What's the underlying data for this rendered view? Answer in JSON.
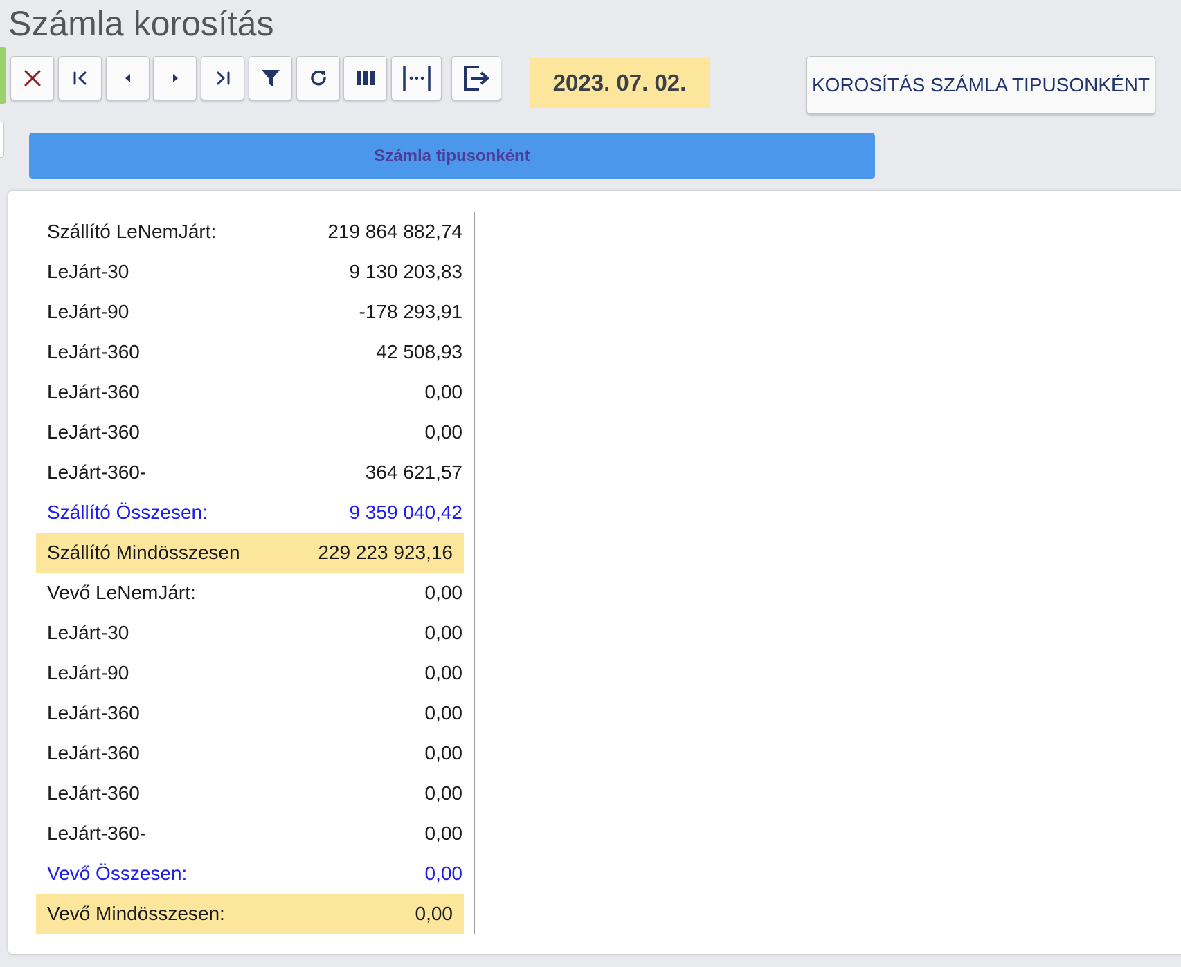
{
  "page": {
    "title": "Számla korosítás"
  },
  "toolbar": {
    "buttons": [
      {
        "name": "close-button",
        "icon": "close-icon"
      },
      {
        "name": "first-record-button",
        "icon": "first-icon"
      },
      {
        "name": "previous-record-button",
        "icon": "prev-icon"
      },
      {
        "name": "next-record-button",
        "icon": "next-icon"
      },
      {
        "name": "last-record-button",
        "icon": "last-icon"
      },
      {
        "name": "filter-button",
        "icon": "filter-icon"
      },
      {
        "name": "refresh-button",
        "icon": "refresh-icon"
      },
      {
        "name": "columns-button",
        "icon": "columns-icon"
      },
      {
        "name": "column-width-button",
        "icon": "column-width-icon"
      },
      {
        "name": "export-button",
        "icon": "export-icon"
      }
    ],
    "date": "2023. 07. 02.",
    "report_button_label": "KOROSÍTÁS SZÁMLA TIPUSONKÉNT"
  },
  "tab": {
    "label": "Számla tipusonként"
  },
  "colors": {
    "background": "#e9eaee",
    "tab_bar": "#4a97ec",
    "tab_text": "#4e3c98",
    "highlight": "#fce69c",
    "subtotal_text": "#1d1ded",
    "close_icon": "#8c1f1f",
    "toolbar_icon": "#22356a"
  },
  "rows": [
    {
      "label": "Szállító LeNemJárt:",
      "value": "219 864 882,74",
      "kind": "normal"
    },
    {
      "label": "LeJárt-30",
      "value": "9 130 203,83",
      "kind": "normal"
    },
    {
      "label": "LeJárt-90",
      "value": "-178 293,91",
      "kind": "normal"
    },
    {
      "label": "LeJárt-360",
      "value": "42 508,93",
      "kind": "normal"
    },
    {
      "label": "LeJárt-360",
      "value": "0,00",
      "kind": "normal"
    },
    {
      "label": "LeJárt-360",
      "value": "0,00",
      "kind": "normal"
    },
    {
      "label": "LeJárt-360-",
      "value": "364 621,57",
      "kind": "normal"
    },
    {
      "label": "Szállító Összesen:",
      "value": "9 359 040,42",
      "kind": "subtotal"
    },
    {
      "label": "Szállító Mindösszesen",
      "value": "229 223 923,16",
      "kind": "grand"
    },
    {
      "label": "Vevő LeNemJárt:",
      "value": "0,00",
      "kind": "normal"
    },
    {
      "label": "LeJárt-30",
      "value": "0,00",
      "kind": "normal"
    },
    {
      "label": "LeJárt-90",
      "value": "0,00",
      "kind": "normal"
    },
    {
      "label": "LeJárt-360",
      "value": "0,00",
      "kind": "normal"
    },
    {
      "label": "LeJárt-360",
      "value": "0,00",
      "kind": "normal"
    },
    {
      "label": "LeJárt-360",
      "value": "0,00",
      "kind": "normal"
    },
    {
      "label": "LeJárt-360-",
      "value": "0,00",
      "kind": "normal"
    },
    {
      "label": "Vevő Összesen:",
      "value": "0,00",
      "kind": "subtotal"
    },
    {
      "label": "Vevő Mindösszesen:",
      "value": "0,00",
      "kind": "grand"
    }
  ]
}
